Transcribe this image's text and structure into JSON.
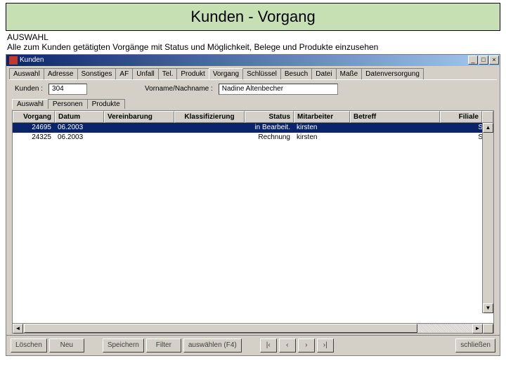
{
  "slide": {
    "title": "Kunden - Vorgang",
    "desc_line1": "AUSWAHL",
    "desc_line2": "Alle zum Kunden getätigten Vorgänge mit Status und Möglichkeit, Belege und Produkte einzusehen"
  },
  "window": {
    "title": "Kunden",
    "min": "_",
    "max": "□",
    "close": "×"
  },
  "tabs": {
    "items": [
      "Auswahl",
      "Adresse",
      "Sonstiges",
      "AF",
      "Unfall",
      "Tel.",
      "Produkt",
      "Vorgang",
      "Schlüssel",
      "Besuch",
      "Datei",
      "Maße",
      "Datenversorgung"
    ],
    "active_index": 7
  },
  "fields": {
    "kunden_label": "Kunden :",
    "kunden_value": "304",
    "name_label": "Vorname/Nachname :",
    "name_value": "Nadine Altenbecher"
  },
  "subtabs": {
    "items": [
      "Auswahl",
      "Personen",
      "Produkte"
    ],
    "active_index": 0
  },
  "grid": {
    "headers": {
      "vorgang": "Vorgang",
      "datum": "Datum",
      "vereinbarung": "Vereinbarung",
      "klass": "Klassifizierung",
      "status": "Status",
      "mitarbeiter": "Mitarbeiter",
      "betreff": "Betreff",
      "filiale": "Filiale"
    },
    "rows": [
      {
        "vorgang": "24695",
        "datum": "06.2003",
        "verein": "",
        "klass": "",
        "status": "in Bearbeit.",
        "mitarb": "kirsten",
        "betreff": "",
        "filiale": "SIC"
      },
      {
        "vorgang": "24325",
        "datum": "06.2003",
        "verein": "",
        "klass": "",
        "status": "Rechnung",
        "mitarb": "kirsten",
        "betreff": "",
        "filiale": "SIC"
      }
    ]
  },
  "buttons": {
    "loeschen": "Löschen",
    "neu": "Neu",
    "speichern": "Speichern",
    "filter": "Filter",
    "auswaehlen": "auswählen (F4)",
    "first": "|‹",
    "prev": "‹",
    "next": "›",
    "last": "›|",
    "schliessen": "schließen"
  }
}
